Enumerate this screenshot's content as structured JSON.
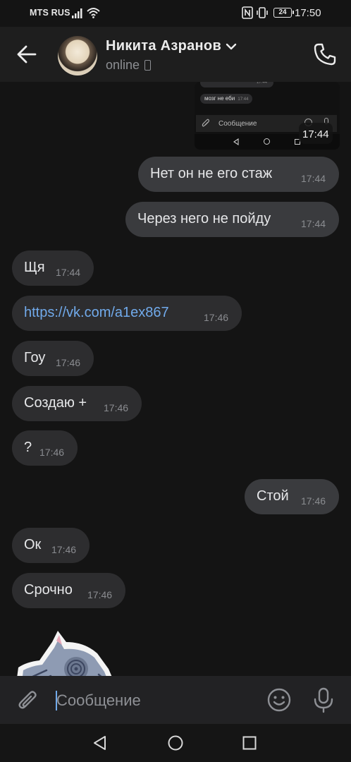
{
  "status_bar": {
    "carrier": "MTS RUS",
    "battery": "24",
    "time": "17:50"
  },
  "header": {
    "name": "Никита Азранов",
    "status": "online"
  },
  "forwarded_screenshot": {
    "bubble_1_time": "17:44",
    "bubble_2_text": "мозг не еби",
    "bubble_2_time": "17:44",
    "input_placeholder": "Сообщение",
    "time": "17:44"
  },
  "messages": [
    {
      "text": "Нет он не его стаж",
      "time": "17:44",
      "outgoing": true
    },
    {
      "text": "Через него не пойду",
      "time": "17:44",
      "outgoing": true
    },
    {
      "text": "Щя",
      "time": "17:44",
      "outgoing": false
    },
    {
      "text": "https://vk.com/a1ex867",
      "time": "17:46",
      "outgoing": false,
      "link": true
    },
    {
      "text": "Гоу",
      "time": "17:46",
      "outgoing": false
    },
    {
      "text": "Создаю +",
      "time": "17:46",
      "outgoing": false
    },
    {
      "text": "?",
      "time": "17:46",
      "outgoing": false
    },
    {
      "text": "Стой",
      "time": "17:46",
      "outgoing": true
    },
    {
      "text": "Ок",
      "time": "17:46",
      "outgoing": false
    },
    {
      "text": "Срочно",
      "time": "17:46",
      "outgoing": false
    }
  ],
  "composer": {
    "placeholder": "Сообщение"
  },
  "colors": {
    "background": "#141414",
    "bubble": "#2d2d2f",
    "link": "#71aaeb",
    "accent": "#71aaeb"
  },
  "icons": [
    "back-arrow-icon",
    "chevron-down-icon",
    "phone-icon",
    "paperclip-icon",
    "smile-icon",
    "microphone-icon",
    "nav-back-icon",
    "nav-home-icon",
    "nav-recent-icon"
  ]
}
